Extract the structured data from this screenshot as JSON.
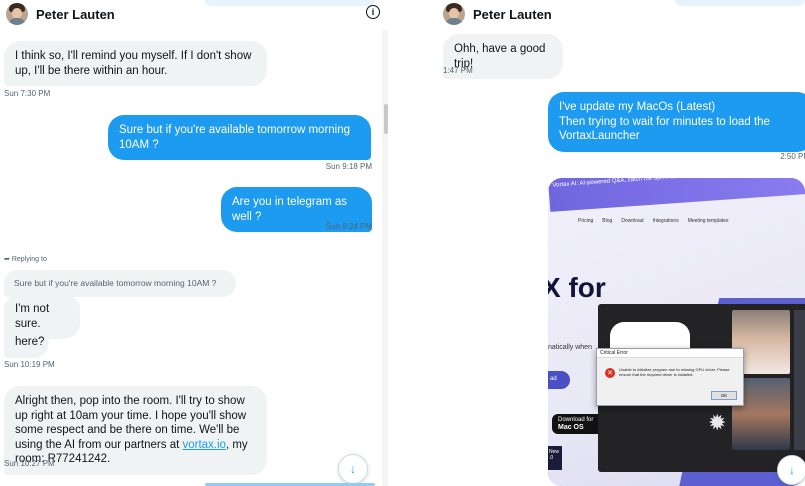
{
  "left_pane": {
    "contact_name": "Peter Lauten",
    "messages": [
      {
        "text": "I think so, I'll remind you myself. If I don't show up, I'll be there within an hour.",
        "time": "Sun 7:30 PM"
      },
      {
        "text": "Sure but if you're available tomorrow morning 10AM ?",
        "time": "Sun 9:18 PM"
      },
      {
        "text": "Are you in telegram as well ?",
        "time": "Sun 9:24 PM"
      },
      {
        "replying_label": "Replying to",
        "quoted": "Sure but if you're available tomorrow morning 10AM ?",
        "text": "I'm not sure."
      },
      {
        "text": "here?",
        "time": "Sun 10:19 PM"
      },
      {
        "text_before_link": "Alright then, pop into the room. I'll try to show up right at 10am your time. I hope you'll show some respect and be there on time. We'll be using the AI from our partners at ",
        "link": "vortax.io",
        "text_after_link": ", my room: R77241242.",
        "time": "Sun 10:27 PM"
      }
    ]
  },
  "right_pane": {
    "contact_name": "Peter Lauten",
    "messages": [
      {
        "text": "Ohh, have a good trip!",
        "time": "1:47 PM"
      },
      {
        "text": "I've update my MacOs (Latest)\nThen trying to wait for minutes to load the VortaxLauncher",
        "time": "2:50 PM"
      }
    ],
    "screenshot": {
      "banner": "Vortax AI: AI-powered Q&A, catch me up, AI summaries, AI action items, & Zapier!",
      "nav": [
        "Pricing",
        "Blog",
        "Download",
        "Integrations",
        "Meeting templates"
      ],
      "hero": "X for",
      "subhero": "natically when",
      "pill": "ad",
      "download_label": "Download for",
      "download_os": "Mac OS",
      "new_label": "New",
      "new_value": ".0",
      "app_mark": "X",
      "dialog_title": "Critical Error",
      "dialog_text": "Unable to initialize program due to missing GPU driver. Please ensure that the required driver is installed.",
      "ok_label": "OK"
    }
  },
  "icons": {
    "info": "info-icon",
    "scroll_down": "arrow-down-icon",
    "error": "error-icon"
  },
  "colors": {
    "accent": "#1d9bf0",
    "incoming_bubble": "#eff3f4"
  }
}
